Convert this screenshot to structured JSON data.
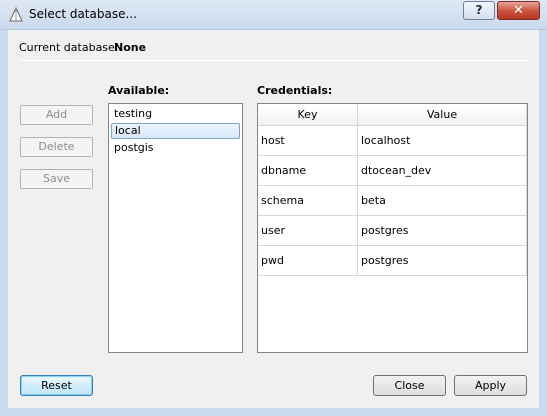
{
  "window": {
    "title": "Select database...",
    "help_label": "?",
    "close_label": "✕"
  },
  "current": {
    "label": "Current database:",
    "value": "None"
  },
  "side_buttons": {
    "add": "Add",
    "delete": "Delete",
    "save": "Save"
  },
  "available": {
    "label": "Available:",
    "items": [
      "testing",
      "local",
      "postgis"
    ],
    "selected": "local"
  },
  "credentials": {
    "label": "Credentials:",
    "headers": [
      "Key",
      "Value"
    ],
    "rows": [
      [
        "host",
        "localhost"
      ],
      [
        "dbname",
        "dtocean_dev"
      ],
      [
        "schema",
        "beta"
      ],
      [
        "user",
        "postgres"
      ],
      [
        "pwd",
        "postgres"
      ]
    ]
  },
  "footer": {
    "reset": "Reset",
    "close": "Close",
    "apply": "Apply"
  }
}
